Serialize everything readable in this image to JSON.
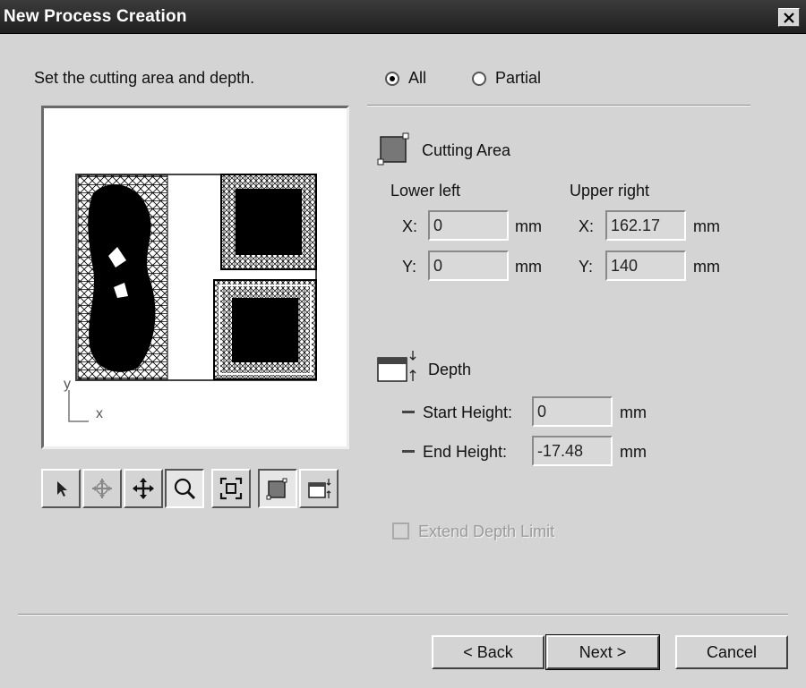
{
  "window": {
    "title": "New Process Creation",
    "close_label": "close"
  },
  "instruction": "Set the cutting area and depth.",
  "range": {
    "all_label": "All",
    "partial_label": "Partial",
    "selected": "All"
  },
  "preview": {
    "axis_y": "y",
    "axis_x": "x"
  },
  "toolbar": [
    "select-arrow",
    "rotate",
    "pan",
    "zoom",
    "fit",
    "cutting-area",
    "depth"
  ],
  "cutting_area": {
    "heading": "Cutting Area",
    "lower_left_label": "Lower left",
    "upper_right_label": "Upper right",
    "x_label": "X:",
    "y_label": "Y:",
    "lower_left_x": "0",
    "lower_left_y": "0",
    "upper_right_x": "162.17",
    "upper_right_y": "140",
    "unit": "mm"
  },
  "depth": {
    "heading": "Depth",
    "start_label": "Start Height:",
    "start_value": "0",
    "end_label": "End Height:",
    "end_value": "-17.48",
    "unit": "mm"
  },
  "extend_depth_limit": {
    "label": "Extend Depth Limit",
    "checked": false,
    "enabled": false
  },
  "buttons": {
    "back": "< Back",
    "next": "Next >",
    "cancel": "Cancel"
  }
}
